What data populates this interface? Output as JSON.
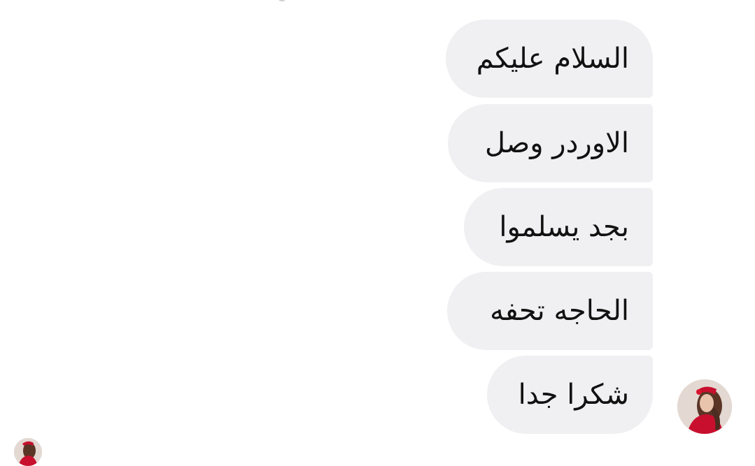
{
  "conversation": {
    "messages": [
      {
        "text": "السلام عليكم"
      },
      {
        "text": "الاوردر وصل"
      },
      {
        "text": "بجد يسلموا"
      },
      {
        "text": "الحاجه تحفه"
      },
      {
        "text": "شكرا جدا"
      }
    ],
    "bubble_color": "#f0f0f2",
    "text_color": "#111111",
    "sender_avatar": "profile-photo",
    "seen_avatar": "profile-photo"
  }
}
